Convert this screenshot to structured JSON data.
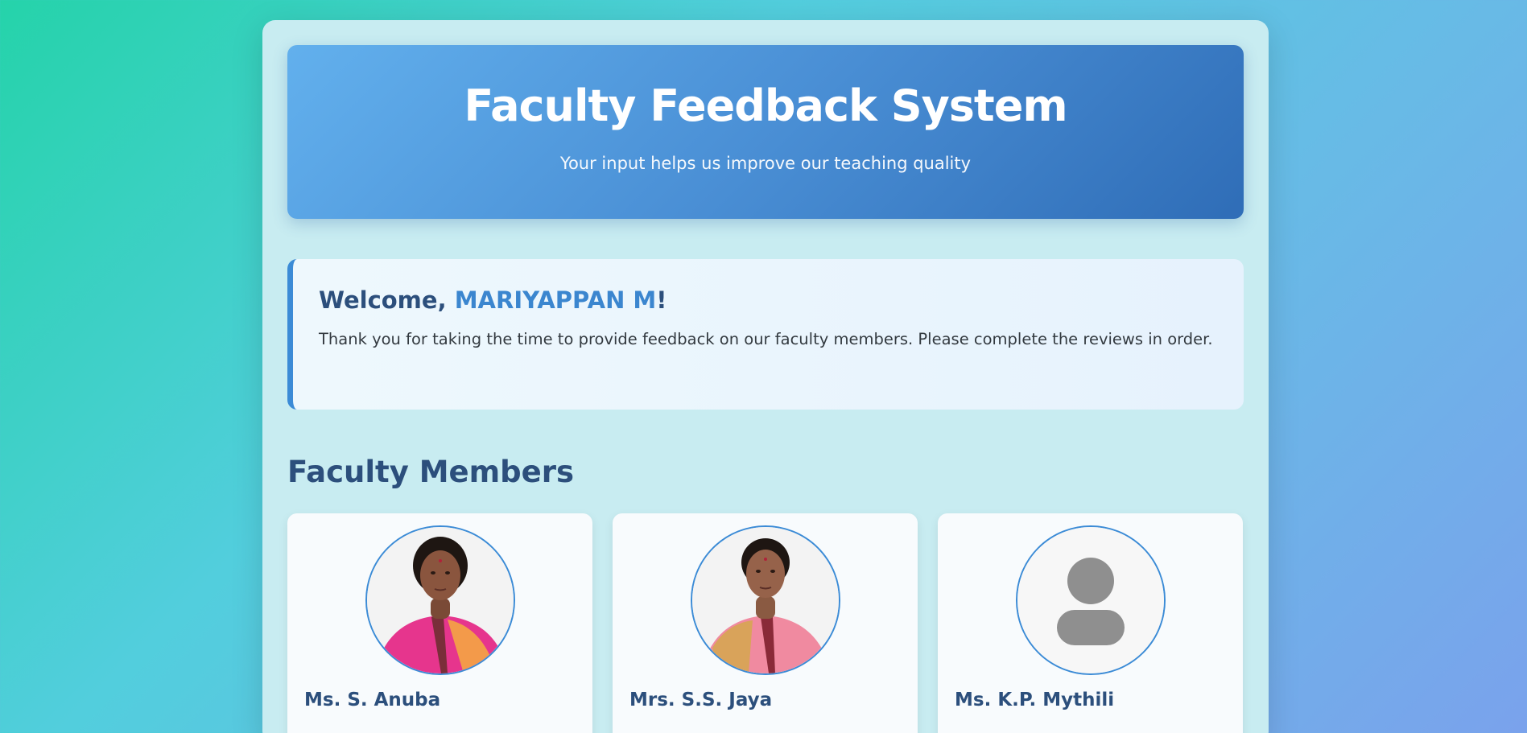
{
  "header": {
    "title": "Faculty Feedback System",
    "subtitle": "Your input helps us improve our teaching quality"
  },
  "welcome": {
    "greeting": "Welcome, ",
    "user_name": "MARIYAPPAN M",
    "exclaim": "!",
    "message": "Thank you for taking the time to provide feedback on our faculty members. Please complete the reviews in order."
  },
  "faculty": {
    "section_title": "Faculty Members",
    "members": [
      {
        "name": "Ms. S. Anuba",
        "photo": "portrait-photo",
        "saree_color": "#e83e8c"
      },
      {
        "name": "Mrs. S.S. Jaya",
        "photo": "portrait-photo",
        "saree_color": "#f08aa0"
      },
      {
        "name": "Ms. K.P. Mythili",
        "photo": "default-user-icon"
      }
    ]
  },
  "colors": {
    "accent": "#3b8bd6",
    "heading": "#2c4f7c",
    "header_gradient_start": "#62b0ed",
    "header_gradient_end": "#2f6db7"
  }
}
